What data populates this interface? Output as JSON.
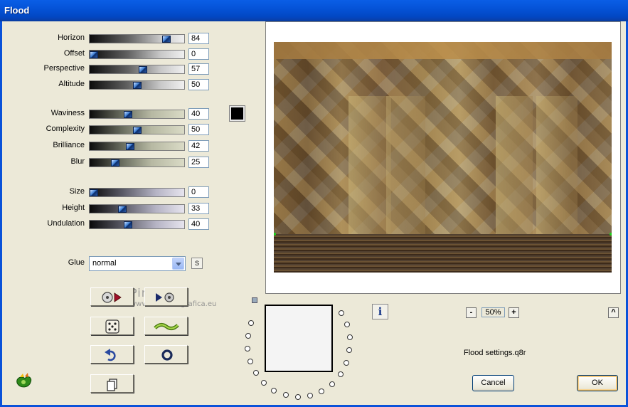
{
  "window": {
    "title": "Flood"
  },
  "sliders": [
    {
      "id": "horizon",
      "label": "Horizon",
      "value": 84,
      "gradient": "gray"
    },
    {
      "id": "offset",
      "label": "Offset",
      "value": 0,
      "gradient": "gray"
    },
    {
      "id": "perspective",
      "label": "Perspective",
      "value": 57,
      "gradient": "gray"
    },
    {
      "id": "altitude",
      "label": "Altitude",
      "value": 50,
      "gradient": "gray"
    },
    {
      "id": "waviness",
      "label": "Waviness",
      "value": 40,
      "gradient": "green"
    },
    {
      "id": "complexity",
      "label": "Complexity",
      "value": 50,
      "gradient": "green"
    },
    {
      "id": "brilliance",
      "label": "Brilliance",
      "value": 42,
      "gradient": "green"
    },
    {
      "id": "blur",
      "label": "Blur",
      "value": 25,
      "gradient": "green"
    },
    {
      "id": "size",
      "label": "Size",
      "value": 0,
      "gradient": "lilac"
    },
    {
      "id": "height",
      "label": "Height",
      "value": 33,
      "gradient": "lilac"
    },
    {
      "id": "undulation",
      "label": "Undulation",
      "value": 40,
      "gradient": "lilac"
    }
  ],
  "color_swatch": {
    "color": "#000000"
  },
  "glue": {
    "label": "Glue",
    "value": "normal",
    "s_label": "S"
  },
  "icon_buttons": [
    {
      "id": "randomize-reset",
      "icon": "disc-play-icon"
    },
    {
      "id": "play-options",
      "icon": "play-disc-icon"
    },
    {
      "id": "random",
      "icon": "dice-icon"
    },
    {
      "id": "wave",
      "icon": "wave-icon"
    },
    {
      "id": "undo",
      "icon": "undo-icon"
    },
    {
      "id": "reset",
      "icon": "ring-icon"
    },
    {
      "id": "copy",
      "icon": "copy-icon"
    }
  ],
  "zoom": {
    "minus": "-",
    "value": "50%",
    "plus": "+",
    "collapse": "^"
  },
  "info_label": "i",
  "settings_file": "Flood settings.q8r",
  "buttons": {
    "cancel": "Cancel",
    "ok": "OK"
  },
  "watermark": {
    "line1": "Pinuccia",
    "line2": "www.maidissegrafica.eu"
  }
}
